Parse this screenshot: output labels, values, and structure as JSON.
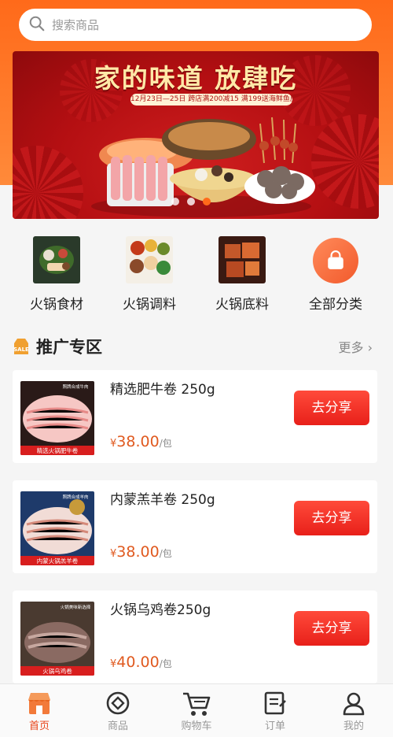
{
  "search": {
    "placeholder": "搜索商品"
  },
  "banner": {
    "title": "家的味道 放肆吃",
    "subtitle": "12月23日—25日 跨店满200减15 满199送海鲜鱼皮1份",
    "dots": 3,
    "active_dot": 3
  },
  "categories": [
    {
      "label": "火锅食材",
      "icon": "ingredients-photo"
    },
    {
      "label": "火锅调料",
      "icon": "sauces-photo"
    },
    {
      "label": "火锅底料",
      "icon": "soup-base-photo"
    },
    {
      "label": "全部分类",
      "icon": "shopping-bag-icon"
    }
  ],
  "section": {
    "title": "推广专区",
    "more_label": "更多"
  },
  "products": [
    {
      "name": "精选肥牛卷 250g",
      "currency": "¥",
      "price": "38.00",
      "unit": "/包",
      "button": "去分享",
      "thumb_caption": "精选火锅肥牛卷",
      "thumb_tag": "照牌合成牛肉"
    },
    {
      "name": "内蒙羔羊卷 250g",
      "currency": "¥",
      "price": "38.00",
      "unit": "/包",
      "button": "去分享",
      "thumb_caption": "内蒙火锅羔羊卷",
      "thumb_tag": "照牌合成羊肉"
    },
    {
      "name": "火锅乌鸡卷250g",
      "currency": "¥",
      "price": "40.00",
      "unit": "/包",
      "button": "去分享",
      "thumb_caption": "火锅乌鸡卷",
      "thumb_tag": "火锅美味新选择"
    }
  ],
  "tabs": [
    {
      "label": "首页",
      "icon": "shop-icon",
      "active": true
    },
    {
      "label": "商品",
      "icon": "tag-icon",
      "active": false
    },
    {
      "label": "购物车",
      "icon": "cart-icon",
      "active": false
    },
    {
      "label": "订单",
      "icon": "order-icon",
      "active": false
    },
    {
      "label": "我的",
      "icon": "user-icon",
      "active": false
    }
  ],
  "colors": {
    "accent": "#ff6a1a",
    "price": "#e05a20",
    "button": "#e8201a",
    "active_tab": "#e8441a"
  }
}
